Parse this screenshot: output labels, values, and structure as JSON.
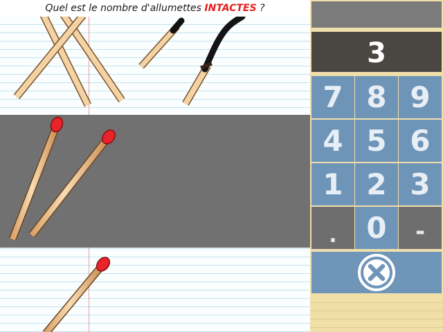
{
  "question": {
    "before": "Quel est le nombre d'allumettes ",
    "highlight": "INTACTES",
    "after": " ?"
  },
  "keypad": {
    "display_value": "3",
    "keys": [
      "7",
      "8",
      "9",
      "4",
      "5",
      "6",
      "1",
      "2",
      "3",
      ".",
      "0",
      "-"
    ],
    "clear_icon": "clear-x-icon"
  },
  "colors": {
    "highlight": "#e31e1e",
    "key_blue": "#6e95b8",
    "key_disabled": "#6e6e6e",
    "match_head": "#e8232a",
    "panel": "#f0deab"
  }
}
